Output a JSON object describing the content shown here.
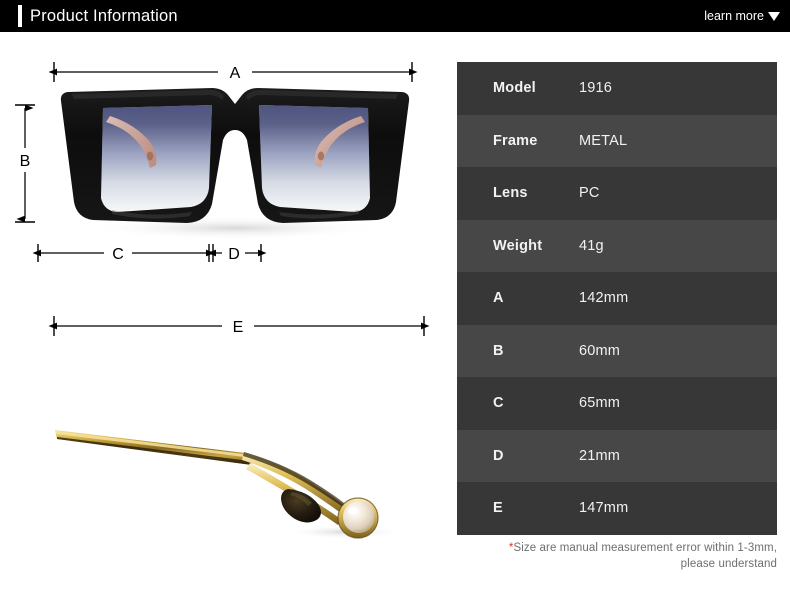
{
  "header": {
    "title": "Product Information",
    "learn_more_label": "learn more",
    "caret_icon": "chevron-down-icon",
    "background_color": "#000000",
    "text_color": "#ffffff",
    "accent_bar_color": "#ffffff"
  },
  "spec_table": {
    "row_color_odd": "#373737",
    "row_color_even": "#474747",
    "text_color": "#f2f2f2",
    "rows": [
      {
        "key": "Model",
        "value": "1916"
      },
      {
        "key": "Frame",
        "value": "METAL"
      },
      {
        "key": "Lens",
        "value": "PC"
      },
      {
        "key": "Weight",
        "value": "41g"
      },
      {
        "key": "A",
        "value": "142mm"
      },
      {
        "key": "B",
        "value": "60mm"
      },
      {
        "key": "C",
        "value": "65mm"
      },
      {
        "key": "D",
        "value": "21mm"
      },
      {
        "key": "E",
        "value": "147mm"
      }
    ]
  },
  "footnote": {
    "asterisk": "*",
    "line1": "Size are manual measurement error within 1-3mm,",
    "line2": "please understand",
    "asterisk_color": "#e0302a",
    "text_color": "#6e6e6e"
  },
  "diagram": {
    "front_view": {
      "name": "sunglasses-front-view",
      "frame_color": "#111111",
      "lens_gradient_top": "#5a5f85",
      "lens_gradient_bottom": "#f2f4f6",
      "temple_tip_color": "#d8b4a8"
    },
    "side_view": {
      "name": "sunglasses-temple-side-view",
      "metal_color": "#c9a227",
      "metal_highlight": "#f0dc8a",
      "accent_color": "#1a1410",
      "pearl_color": "#f3ead8"
    },
    "dimension_labels": [
      {
        "id": "A",
        "label": "A",
        "orientation": "horizontal",
        "view": "front",
        "position": "top"
      },
      {
        "id": "B",
        "label": "B",
        "orientation": "vertical",
        "view": "front",
        "position": "left"
      },
      {
        "id": "C",
        "label": "C",
        "orientation": "horizontal",
        "view": "front",
        "position": "bottom-left"
      },
      {
        "id": "D",
        "label": "D",
        "orientation": "horizontal",
        "view": "front",
        "position": "bottom-right"
      },
      {
        "id": "E",
        "label": "E",
        "orientation": "horizontal",
        "view": "side",
        "position": "top"
      }
    ],
    "line_color": "#000000"
  }
}
